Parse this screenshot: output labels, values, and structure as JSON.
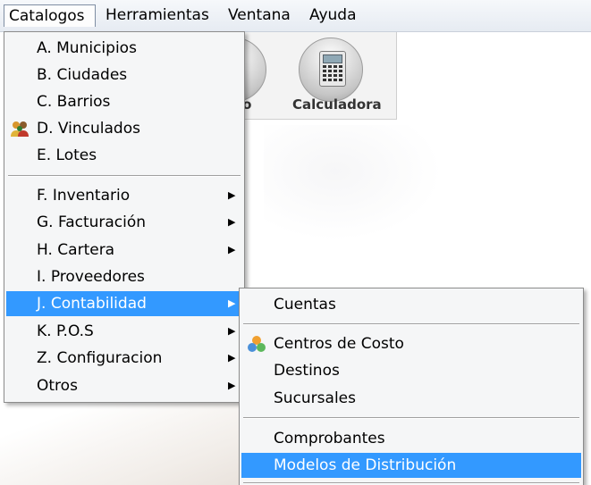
{
  "menubar": {
    "items": [
      {
        "label": "Catalogos",
        "open": true
      },
      {
        "label": "Herramientas"
      },
      {
        "label": "Ventana"
      },
      {
        "label": "Ayuda"
      }
    ]
  },
  "toolbar": {
    "buttons": [
      {
        "label": "to",
        "icon": "partial-tool-icon"
      },
      {
        "label": "Calculadora",
        "icon": "calculator-icon"
      }
    ]
  },
  "catalogos_menu": {
    "items": [
      {
        "label": "A. Municipios",
        "has_submenu": false
      },
      {
        "label": "B. Ciudades",
        "has_submenu": false
      },
      {
        "label": "C. Barrios",
        "has_submenu": false
      },
      {
        "label": "D. Vinculados",
        "has_submenu": false,
        "icon": "people-group-icon"
      },
      {
        "label": "E. Lotes",
        "has_submenu": false
      },
      {
        "label": "F.  Inventario",
        "has_submenu": true
      },
      {
        "label": "G. Facturación",
        "has_submenu": true
      },
      {
        "label": "H. Cartera",
        "has_submenu": true
      },
      {
        "label": "I.  Proveedores",
        "has_submenu": false
      },
      {
        "label": "J. Contabilidad",
        "has_submenu": true,
        "highlighted": true
      },
      {
        "label": "K. P.O.S",
        "has_submenu": true
      },
      {
        "label": "Z. Configuracion",
        "has_submenu": true
      },
      {
        "label": "Otros",
        "has_submenu": true
      }
    ]
  },
  "contabilidad_submenu": {
    "items": [
      {
        "label": "Cuentas"
      },
      {
        "label": "Centros de Costo",
        "icon": "cost-centers-icon"
      },
      {
        "label": "Destinos"
      },
      {
        "label": "Sucursales"
      },
      {
        "label": "Comprobantes"
      },
      {
        "label": "Modelos de Distribución",
        "highlighted": true
      }
    ]
  },
  "colors": {
    "highlight": "#3399ff",
    "menu_bg": "#f5f6f7"
  }
}
